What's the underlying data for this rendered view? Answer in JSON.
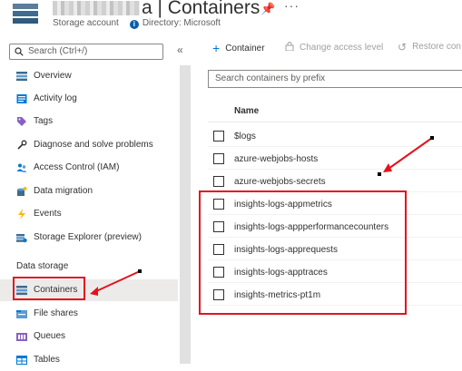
{
  "header": {
    "title_suffix": "a | Containers",
    "subtitle_type": "Storage account",
    "subtitle_directory": "Directory: Microsoft",
    "pin_glyph": "📌",
    "more_glyph": "···"
  },
  "sidebar": {
    "search_placeholder": "Search (Ctrl+/)",
    "collapse_glyph": "«",
    "items": [
      {
        "label": "Overview",
        "icon": "overview-icon"
      },
      {
        "label": "Activity log",
        "icon": "activity-log-icon"
      },
      {
        "label": "Tags",
        "icon": "tag-icon"
      },
      {
        "label": "Diagnose and solve problems",
        "icon": "wrench-icon"
      },
      {
        "label": "Access Control (IAM)",
        "icon": "people-icon"
      },
      {
        "label": "Data migration",
        "icon": "data-migration-icon"
      },
      {
        "label": "Events",
        "icon": "lightning-icon"
      },
      {
        "label": "Storage Explorer (preview)",
        "icon": "storage-explorer-icon"
      }
    ],
    "section_title": "Data storage",
    "section_items": [
      {
        "label": "Containers",
        "icon": "containers-icon",
        "selected": true
      },
      {
        "label": "File shares",
        "icon": "file-shares-icon"
      },
      {
        "label": "Queues",
        "icon": "queues-icon"
      },
      {
        "label": "Tables",
        "icon": "tables-icon"
      }
    ]
  },
  "toolbar": {
    "add_container_label": "Container",
    "change_access_label": "Change access level",
    "restore_label": "Restore con"
  },
  "main": {
    "filter_placeholder": "Search containers by prefix",
    "column_name": "Name",
    "rows": [
      "$logs",
      "azure-webjobs-hosts",
      "azure-webjobs-secrets",
      "insights-logs-appmetrics",
      "insights-logs-appperformancecounters",
      "insights-logs-apprequests",
      "insights-logs-apptraces",
      "insights-metrics-pt1m"
    ]
  },
  "colors": {
    "accent": "#0078d4",
    "highlight_red": "#e3131d",
    "selected_bg": "#edebe9"
  }
}
